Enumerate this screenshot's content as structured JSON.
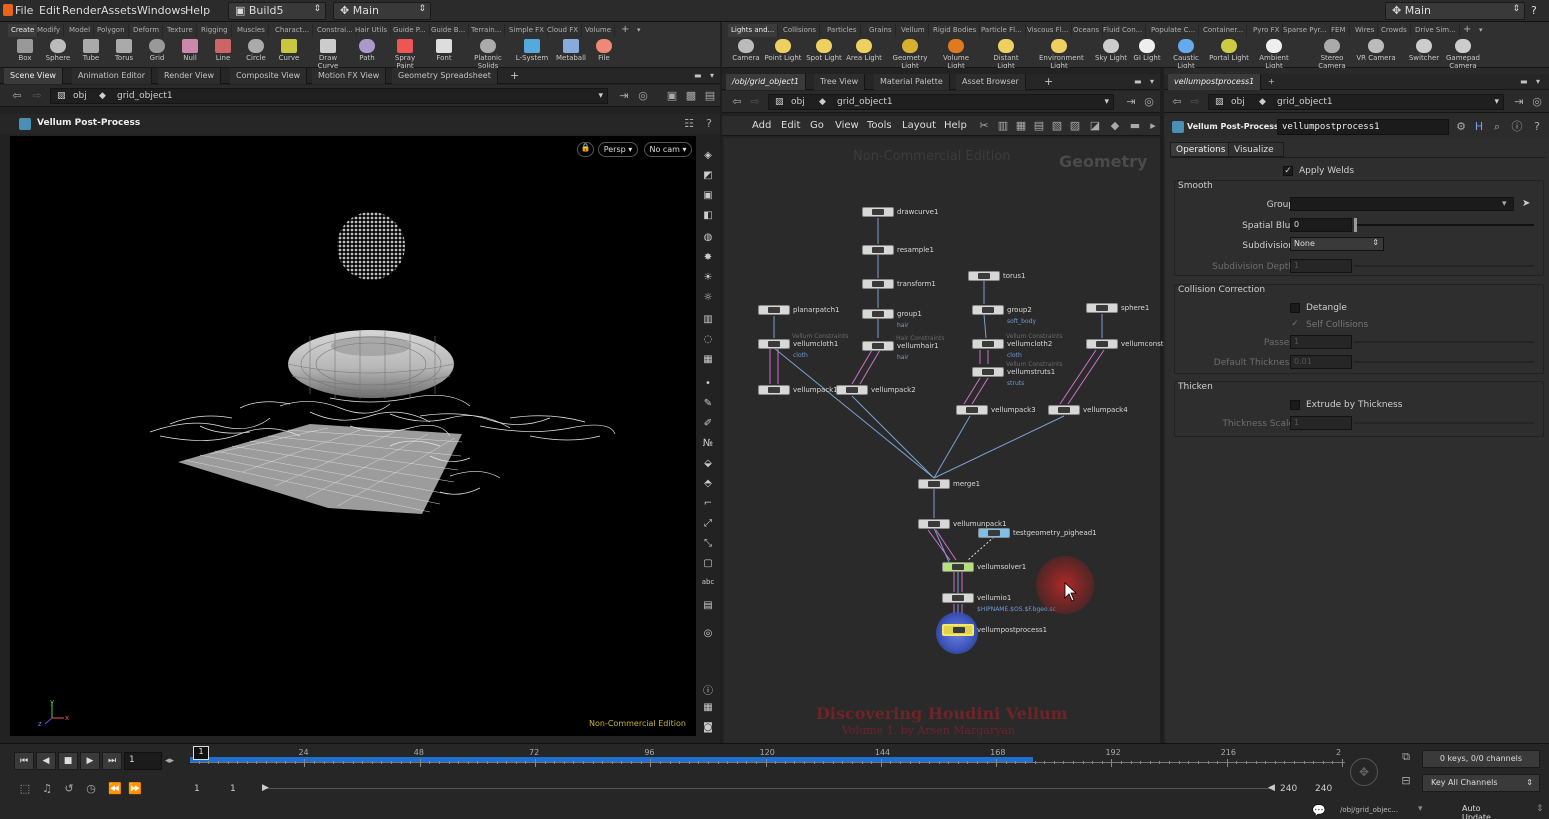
{
  "menubar": {
    "items": [
      "File",
      "Edit",
      "Render",
      "Assets",
      "Windows",
      "Help"
    ],
    "desktop": "Build5",
    "context": "Main",
    "right_desktop": "Main",
    "help": "?"
  },
  "shelf_left": {
    "tabs": [
      "Create",
      "Modify",
      "Model",
      "Polygon",
      "Deform",
      "Texture",
      "Rigging",
      "Muscles",
      "Charact...",
      "Constrai...",
      "Hair Utils",
      "Guide P...",
      "Guide B...",
      "Terrain...",
      "Simple FX",
      "Cloud FX",
      "Volume"
    ],
    "tools": [
      "Box",
      "Sphere",
      "Tube",
      "Torus",
      "Grid",
      "Null",
      "Line",
      "Circle",
      "Curve",
      "Draw Curve",
      "Path",
      "Spray Paint",
      "Font",
      "Platonic Solids",
      "L-System",
      "Metaball",
      "File"
    ]
  },
  "shelf_right": {
    "tabs": [
      "Lights and...",
      "Collisions",
      "Particles",
      "Grains",
      "Vellum",
      "Rigid Bodies",
      "Particle Fl...",
      "Viscous Fl...",
      "Oceans",
      "Fluid Con...",
      "Populate C...",
      "Container...",
      "Pyro FX",
      "Sparse Pyr...",
      "FEM",
      "Wires",
      "Crowds",
      "Drive Sim..."
    ],
    "tools": [
      "Camera",
      "Point Light",
      "Spot Light",
      "Area Light",
      "Geometry Light",
      "Volume Light",
      "Distant Light",
      "Environment Light",
      "Sky Light",
      "GI Light",
      "Caustic Light",
      "Portal Light",
      "Ambient Light",
      "Stereo Camera",
      "VR Camera",
      "Switcher",
      "Gamepad Camera"
    ]
  },
  "left_pane": {
    "tabs": [
      "Scene View",
      "Animation Editor",
      "Render View",
      "Composite View",
      "Motion FX View",
      "Geometry Spreadsheet"
    ],
    "path_root": "obj",
    "path_node": "grid_object1",
    "title": "Vellum Post-Process",
    "persp": "Persp ▾",
    "cam": "No cam ▾",
    "watermark": "Non-Commercial Edition",
    "axis": {
      "y": "y",
      "z": "z",
      "x": "x"
    }
  },
  "mid_pane": {
    "tabs": [
      "/obj/grid_object1",
      "Tree View",
      "Material Palette",
      "Asset Browser"
    ],
    "path_root": "obj",
    "path_node": "grid_object1",
    "menus": [
      "Add",
      "Edit",
      "Go",
      "View",
      "Tools",
      "Layout",
      "Help"
    ],
    "edition": "Non-Commercial Edition",
    "context_label": "Geometry",
    "credit_title": "Discovering Houdini Vellum",
    "credit_sub": "Volume 1.  by Arsen Margaryan",
    "nodes": {
      "drawcurve1": "drawcurve1",
      "resample1": "resample1",
      "transform1": "transform1",
      "torus1": "torus1",
      "planarpatch1": "planarpatch1",
      "group1": "group1",
      "group1_sub": "hair",
      "group2": "group2",
      "group2_sub": "soft_body",
      "sphere1": "sphere1",
      "vellumcloth1": "vellumcloth1",
      "vellumcloth1_sub": "cloth",
      "vellumcloth1_faint": "Vellum Constraints",
      "vellumhair1": "vellumhair1",
      "vellumhair1_sub": "hair",
      "vellumhair1_faint": "Hair Constraints",
      "vellumcloth2": "vellumcloth2",
      "vellumcloth2_sub": "cloth",
      "vellumcloth2_faint": "Vellum Constraints",
      "vellumconstr": "vellumconstr",
      "vellumstruts1": "vellumstruts1",
      "vellumstruts1_sub": "struts",
      "vellumstruts1_faint": "Vellum Constraints",
      "vellumpack1": "vellumpack1",
      "vellumpack2": "vellumpack2",
      "vellumpack3": "vellumpack3",
      "vellumpack4": "vellumpack4",
      "merge1": "merge1",
      "vellumunpack1": "vellumunpack1",
      "testgeometry": "testgeometry_pighead1",
      "vellumsolver1": "vellumsolver1",
      "vellumio1": "vellumio1",
      "vellumio1_sub": "$HIPNAME.$OS.$F.bgeo.sc",
      "vellumpostprocess1": "vellumpostprocess1"
    }
  },
  "right_pane": {
    "tab": "vellumpostprocess1",
    "path_root": "obj",
    "path_node": "grid_object1",
    "node_type": "Vellum Post-Process",
    "node_name": "vellumpostprocess1",
    "tabs": [
      "Operations",
      "Visualize"
    ],
    "apply_welds": "Apply Welds",
    "smooth": {
      "title": "Smooth",
      "group": "Group",
      "group_value": "",
      "spatial_blur": "Spatial Blur",
      "spatial_blur_value": "0",
      "subdivision": "Subdivision",
      "subdivision_value": "None",
      "subdivision_depth": "Subdivision Depth",
      "subdivision_depth_value": "1"
    },
    "collision": {
      "title": "Collision Correction",
      "detangle": "Detangle",
      "self": "Self Collisions",
      "passes": "Passes",
      "passes_value": "1",
      "thickness": "Default Thickness",
      "thickness_value": "0.01"
    },
    "thicken": {
      "title": "Thicken",
      "extrude": "Extrude by Thickness",
      "scale": "Thickness Scale",
      "scale_value": "1"
    }
  },
  "timeline": {
    "frame": "1",
    "marker": "1",
    "ticks": [
      "24",
      "48",
      "72",
      "96",
      "120",
      "144",
      "168",
      "192",
      "216",
      "2"
    ],
    "start": "1",
    "start2": "1",
    "end": "240",
    "end2": "240",
    "keys": "0 keys, 0/0 channels",
    "key_all": "Key All Channels",
    "path": "/obj/grid_objec...",
    "auto": "Auto Update"
  }
}
